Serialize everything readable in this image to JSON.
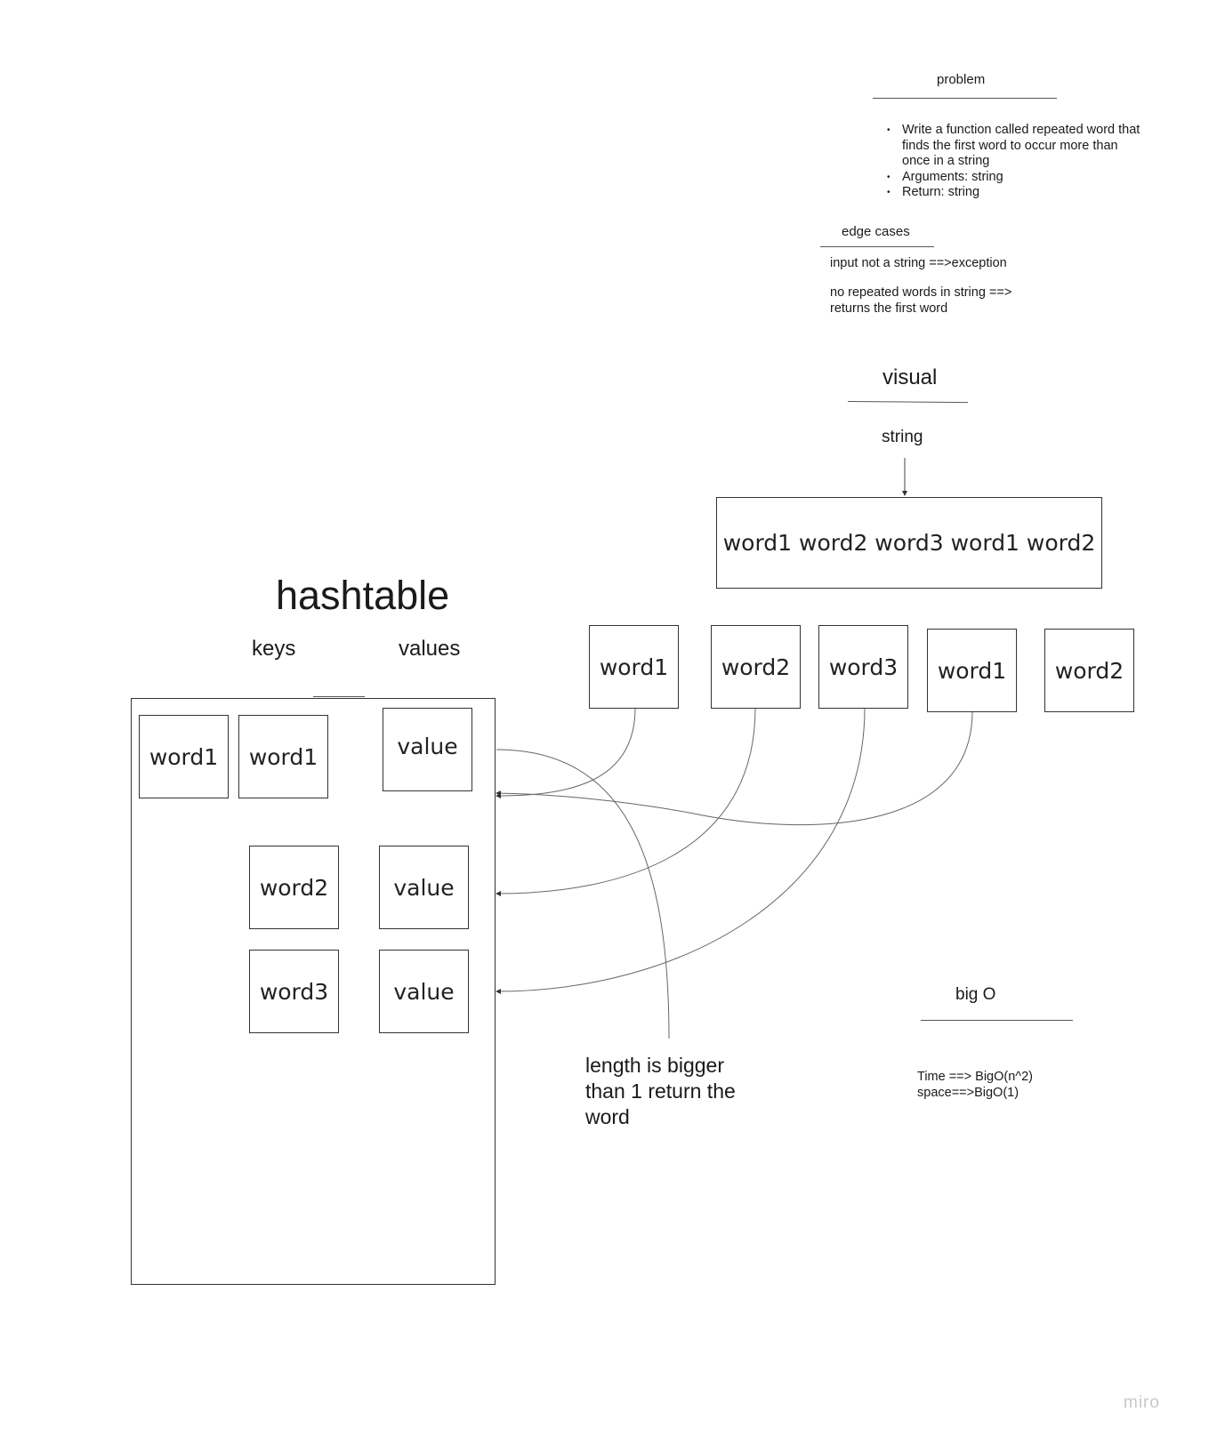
{
  "problem": {
    "title": "problem",
    "bullets": [
      "Write a function called repeated word that finds the first word to occur more than once in a string",
      "Arguments: string",
      "Return: string"
    ]
  },
  "edge_cases": {
    "title": "edge cases",
    "items": [
      "input not a string ==>exception",
      "no repeated words in string ==> returns the first word"
    ]
  },
  "visual": {
    "title": "visual",
    "input_label": "string",
    "input_value": "word1 word2 word3 word1 word2",
    "tokens": [
      "word1",
      "word2",
      "word3",
      "word1",
      "word2"
    ]
  },
  "hashtable": {
    "title": "hashtable",
    "keys_label": "keys",
    "values_label": "values",
    "rows": [
      {
        "keys": [
          "word1",
          "word1"
        ],
        "value": "value"
      },
      {
        "keys": [
          "word2"
        ],
        "value": "value"
      },
      {
        "keys": [
          "word3"
        ],
        "value": "value"
      }
    ]
  },
  "annotation": "length is bigger than 1 return the word",
  "big_o": {
    "title": "big O",
    "time": "Time ==> BigO(n^2)",
    "space": "space==>BigO(1)"
  },
  "watermark": "miro"
}
